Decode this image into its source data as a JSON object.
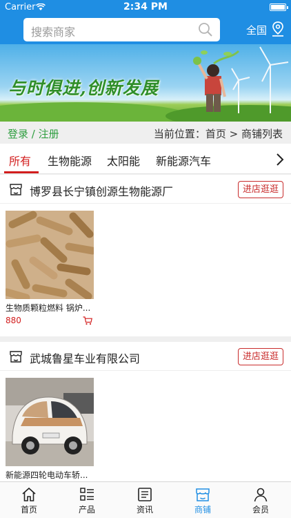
{
  "status_bar": {
    "carrier": "Carrier",
    "time": "2:34 PM"
  },
  "header": {
    "search_placeholder": "搜索商家",
    "region_label": "全国"
  },
  "banner": {
    "slogan": "与时俱进,创新发展"
  },
  "breadcrumb": {
    "login": "登录",
    "separator": "/",
    "register": "注册",
    "location": "当前位置：首页 > 商铺列表"
  },
  "tabs": [
    {
      "label": "所有",
      "active": true
    },
    {
      "label": "生物能源",
      "active": false
    },
    {
      "label": "太阳能",
      "active": false
    },
    {
      "label": "新能源汽车",
      "active": false
    }
  ],
  "shops": [
    {
      "name": "博罗县长宁镇创源生物能源厂",
      "visit_label": "进店逛逛",
      "products": [
        {
          "title": "生物质颗粒燃料 锅炉...",
          "price": "880"
        }
      ]
    },
    {
      "name": "武城鲁星车业有限公司",
      "visit_label": "进店逛逛",
      "products": [
        {
          "title": "新能源四轮电动车轿...",
          "price": ""
        }
      ]
    }
  ],
  "bottom_nav": [
    {
      "label": "首页",
      "icon": "home-icon",
      "active": false
    },
    {
      "label": "产品",
      "icon": "products-icon",
      "active": false
    },
    {
      "label": "资讯",
      "icon": "news-icon",
      "active": false
    },
    {
      "label": "商铺",
      "icon": "shop-icon",
      "active": true
    },
    {
      "label": "会员",
      "icon": "member-icon",
      "active": false
    }
  ],
  "colors": {
    "brand_blue": "#1f8ee3",
    "accent_red": "#d21d1d",
    "login_green": "#2e9e3f"
  }
}
